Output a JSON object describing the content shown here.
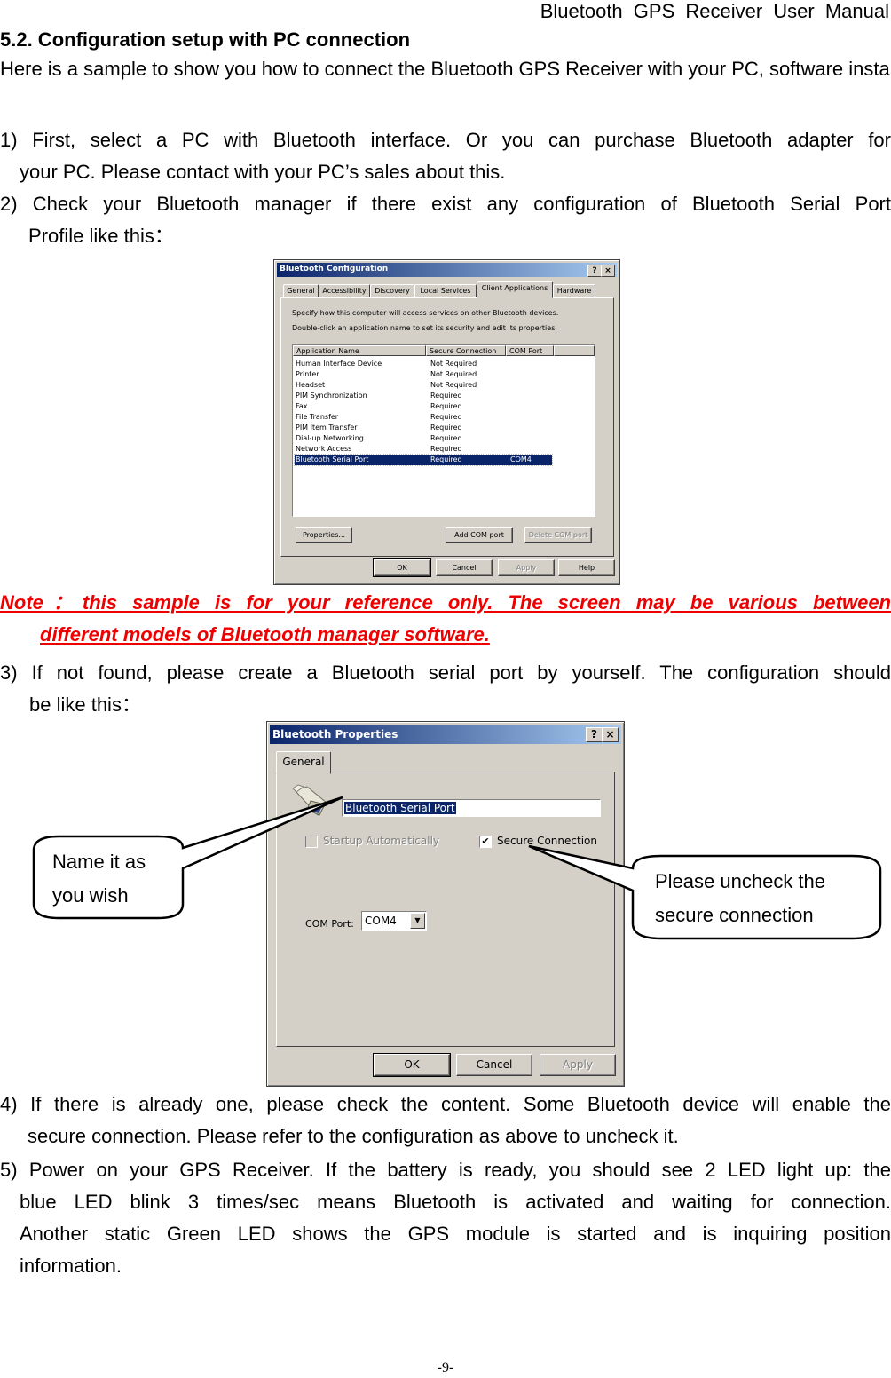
{
  "header": {
    "running_title": "Bluetooth GPS Receiver User Manual"
  },
  "section": {
    "title": "5.2. Configuration setup with PC connection",
    "intro": "Here is a sample to show you how to connect the Bluetooth GPS Receiver with your PC, software install and basic function test."
  },
  "steps": [
    {
      "line1": "1) First, select a PC with Bluetooth interface. Or you can purchase Bluetooth adapter for",
      "line2": "your PC. Please contact with your PC’s sales about this."
    },
    {
      "line1": "2) Check your Bluetooth manager if there exist any configuration of Bluetooth Serial Port",
      "line2": "Profile like this："
    },
    {
      "line1": "3) If not found, please create a Bluetooth serial port by yourself. The configuration should",
      "line2": "be like this："
    },
    {
      "line1": "4) If there is already one, please check the content. Some Bluetooth device will enable the",
      "line2": "secure connection. Please refer to the configuration as above to uncheck it."
    },
    {
      "line1": "5) Power on your GPS Receiver. If the battery is ready, you should see 2 LED light up: the",
      "line2": "blue LED blink 3 times/sec means Bluetooth is activated and waiting for connection.",
      "line3": "Another static Green LED shows the GPS module is started and is inquiring position",
      "line4": "information."
    }
  ],
  "note": {
    "line1": "Note：this sample is for your reference only. The screen may be various between",
    "line2": "different models of Bluetooth manager software.",
    "color": "#ee0000"
  },
  "config_dialog": {
    "title": "Bluetooth Configuration",
    "help_btn": "?",
    "close_btn": "×",
    "tabs": [
      "General",
      "Accessibility",
      "Discovery",
      "Local Services",
      "Client Applications",
      "Hardware"
    ],
    "active_tab": "Client Applications",
    "desc1": "Specify how this computer will access services on other Bluetooth devices.",
    "desc2": "Double-click an application name to set its security and edit its properties.",
    "columns": [
      "Application Name",
      "Secure Connection",
      "COM Port"
    ],
    "rows": [
      {
        "name": "Human Interface Device",
        "secure": "Not Required",
        "port": ""
      },
      {
        "name": "Printer",
        "secure": "Not Required",
        "port": ""
      },
      {
        "name": "Headset",
        "secure": "Not Required",
        "port": ""
      },
      {
        "name": "PIM Synchronization",
        "secure": "Required",
        "port": ""
      },
      {
        "name": "Fax",
        "secure": "Required",
        "port": ""
      },
      {
        "name": "File Transfer",
        "secure": "Required",
        "port": ""
      },
      {
        "name": "PIM Item Transfer",
        "secure": "Required",
        "port": ""
      },
      {
        "name": "Dial-up Networking",
        "secure": "Required",
        "port": ""
      },
      {
        "name": "Network Access",
        "secure": "Required",
        "port": ""
      },
      {
        "name": "Bluetooth Serial Port",
        "secure": "Required",
        "port": "COM4",
        "selected": true
      }
    ],
    "buttons": {
      "properties": "Properties...",
      "add_com": "Add COM port",
      "delete_com": "Delete COM port",
      "ok": "OK",
      "cancel": "Cancel",
      "apply": "Apply",
      "help": "Help"
    }
  },
  "props_dialog": {
    "title": "Bluetooth Properties",
    "help_btn": "?",
    "close_btn": "×",
    "tab": "General",
    "name_value": "Bluetooth Serial Port",
    "startup_label": "Startup Automatically",
    "startup_checked": false,
    "secure_label": "Secure Connection",
    "secure_checked": true,
    "check_mark": "✔",
    "com_label": "COM Port:",
    "com_value": "COM4",
    "dropdown_arrow": "▼",
    "buttons": {
      "ok": "OK",
      "cancel": "Cancel",
      "apply": "Apply"
    }
  },
  "callouts": {
    "name": {
      "line1": "Name it as",
      "line2": "you wish"
    },
    "secure": {
      "line1": "Please uncheck the",
      "line2": "secure connection"
    }
  },
  "page_number": "-9-"
}
